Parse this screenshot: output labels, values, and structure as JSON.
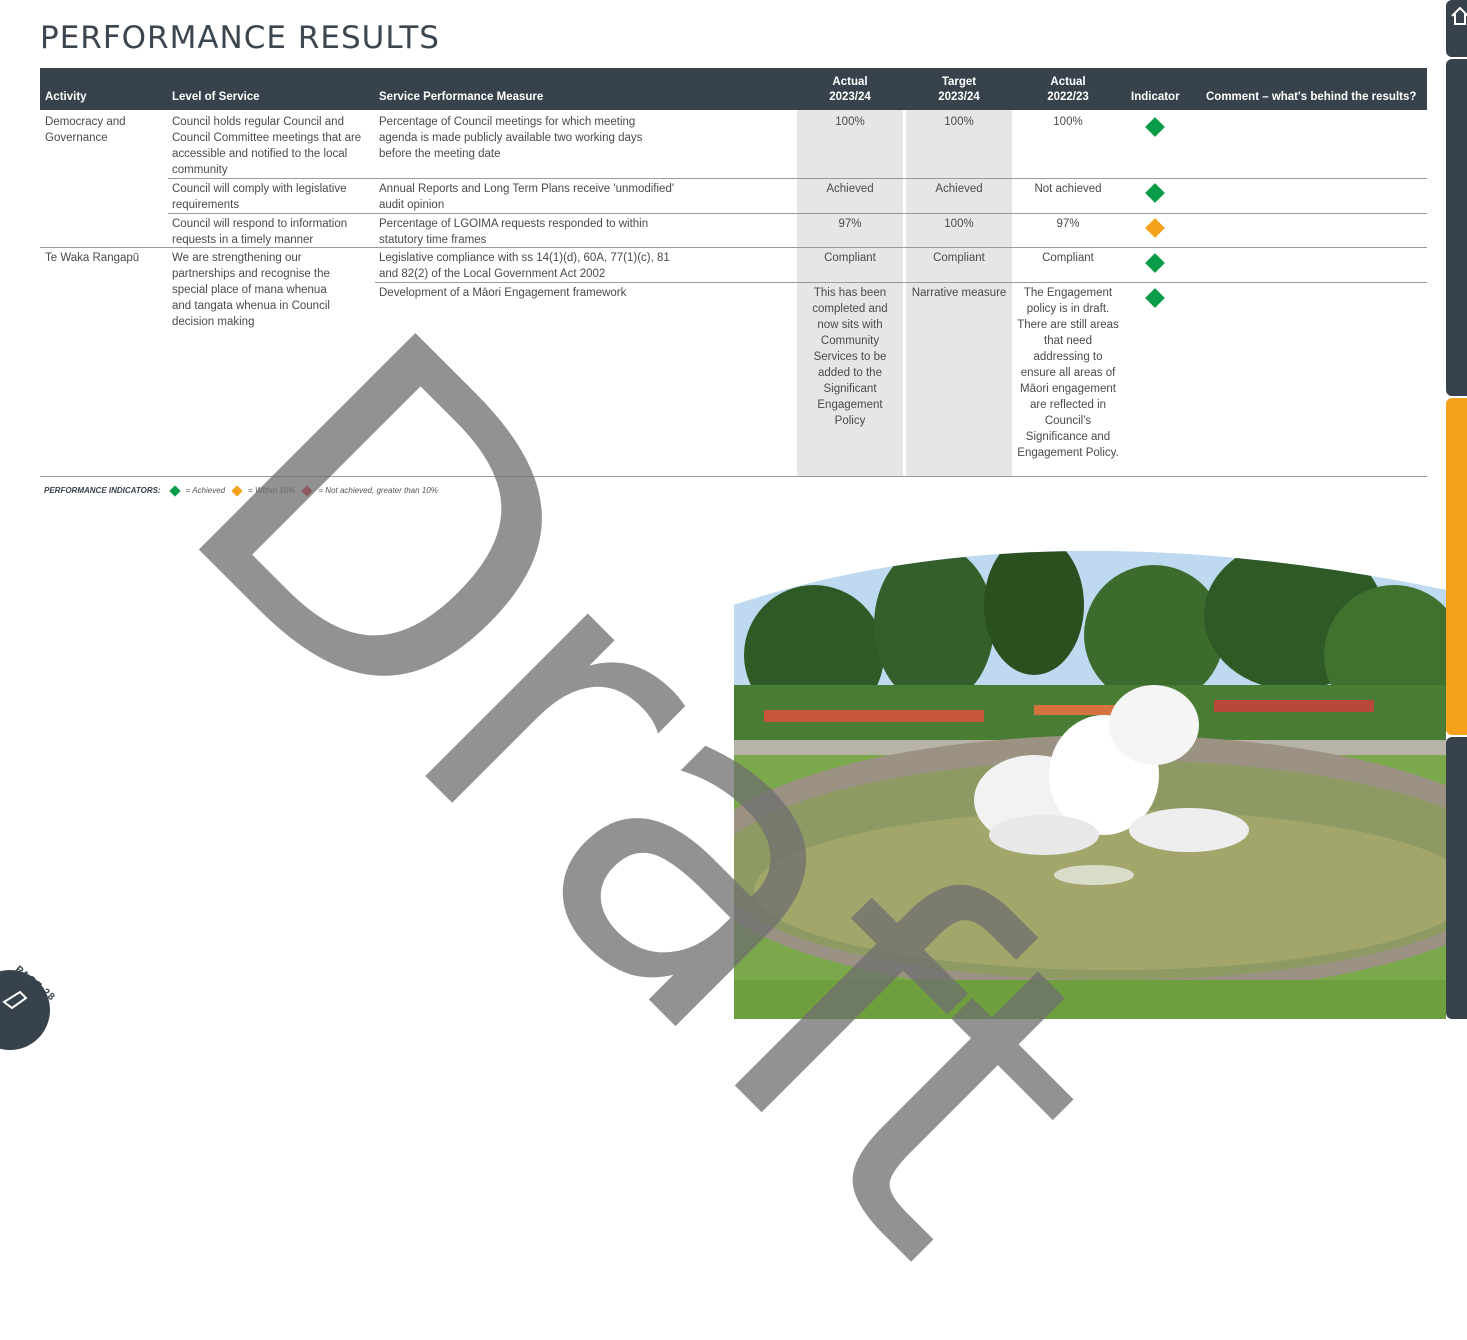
{
  "page": {
    "title": "PERFORMANCE RESULTS",
    "page_label": "PAGE 28",
    "watermark": "Draft"
  },
  "table": {
    "headers": {
      "activity": "Activity",
      "level": "Level of Service",
      "measure": "Service Performance Measure",
      "actual_2324_a": "Actual",
      "actual_2324_b": "2023/24",
      "target_2324_a": "Target",
      "target_2324_b": "2023/24",
      "actual_2223_a": "Actual",
      "actual_2223_b": "2022/23",
      "indicator": "Indicator",
      "comment": "Comment – what's behind the results?"
    },
    "groups": [
      {
        "activity": "Democracy and Governance"
      },
      {
        "activity": "Te Waka Rangapū"
      }
    ],
    "levels": [
      "Council holds regular Council and Council Committee meetings that are accessible and notified to the local community",
      "Council will comply with legislative requirements",
      "Council will respond to information requests in a timely manner",
      "We are strengthening our partnerships and recognise the special place of mana whenua and tangata whenua in Council decision making"
    ],
    "rows": [
      {
        "measure": "Percentage of Council meetings for which meeting agenda is made publicly available two working days before the meeting date",
        "actual_2324": "100%",
        "target_2324": "100%",
        "actual_2223": "100%",
        "indicator": "green"
      },
      {
        "measure": "Annual Reports and Long Term Plans receive 'unmodified' audit opinion",
        "actual_2324": "Achieved",
        "target_2324": "Achieved",
        "actual_2223": "Not achieved",
        "indicator": "green"
      },
      {
        "measure": "Percentage of LGOIMA requests responded to within statutory time frames",
        "actual_2324": "97%",
        "target_2324": "100%",
        "actual_2223": "97%",
        "indicator": "orange"
      },
      {
        "measure": "Legislative compliance with ss 14(1)(d), 60A, 77(1)(c), 81 and 82(2) of the Local Government Act 2002",
        "actual_2324": "Compliant",
        "target_2324": "Compliant",
        "actual_2223": "Compliant",
        "indicator": "green"
      },
      {
        "measure": "Development of a Māori Engagement framework",
        "actual_2324": "This has been completed and now sits with Community Services to be added to the Significant Engagement Policy",
        "target_2324": "Narrative measure",
        "actual_2223": "The Engagement policy is in draft. There are still areas that need addressing to ensure all areas of Māori engagement are reflected in Council's Significance and Engagement Policy.",
        "indicator": "green"
      }
    ]
  },
  "legend": {
    "label": "PERFORMANCE INDICATORS:",
    "achieved": "= Achieved",
    "within": "= Within 10%",
    "not_achieved": "= Not achieved, greater than 10%"
  },
  "colors": {
    "header_bg": "#37424d",
    "achieved": "#0a9b4b",
    "within": "#f5a11c",
    "not_achieved": "#e52329",
    "tab_orange": "#f5a11c"
  }
}
